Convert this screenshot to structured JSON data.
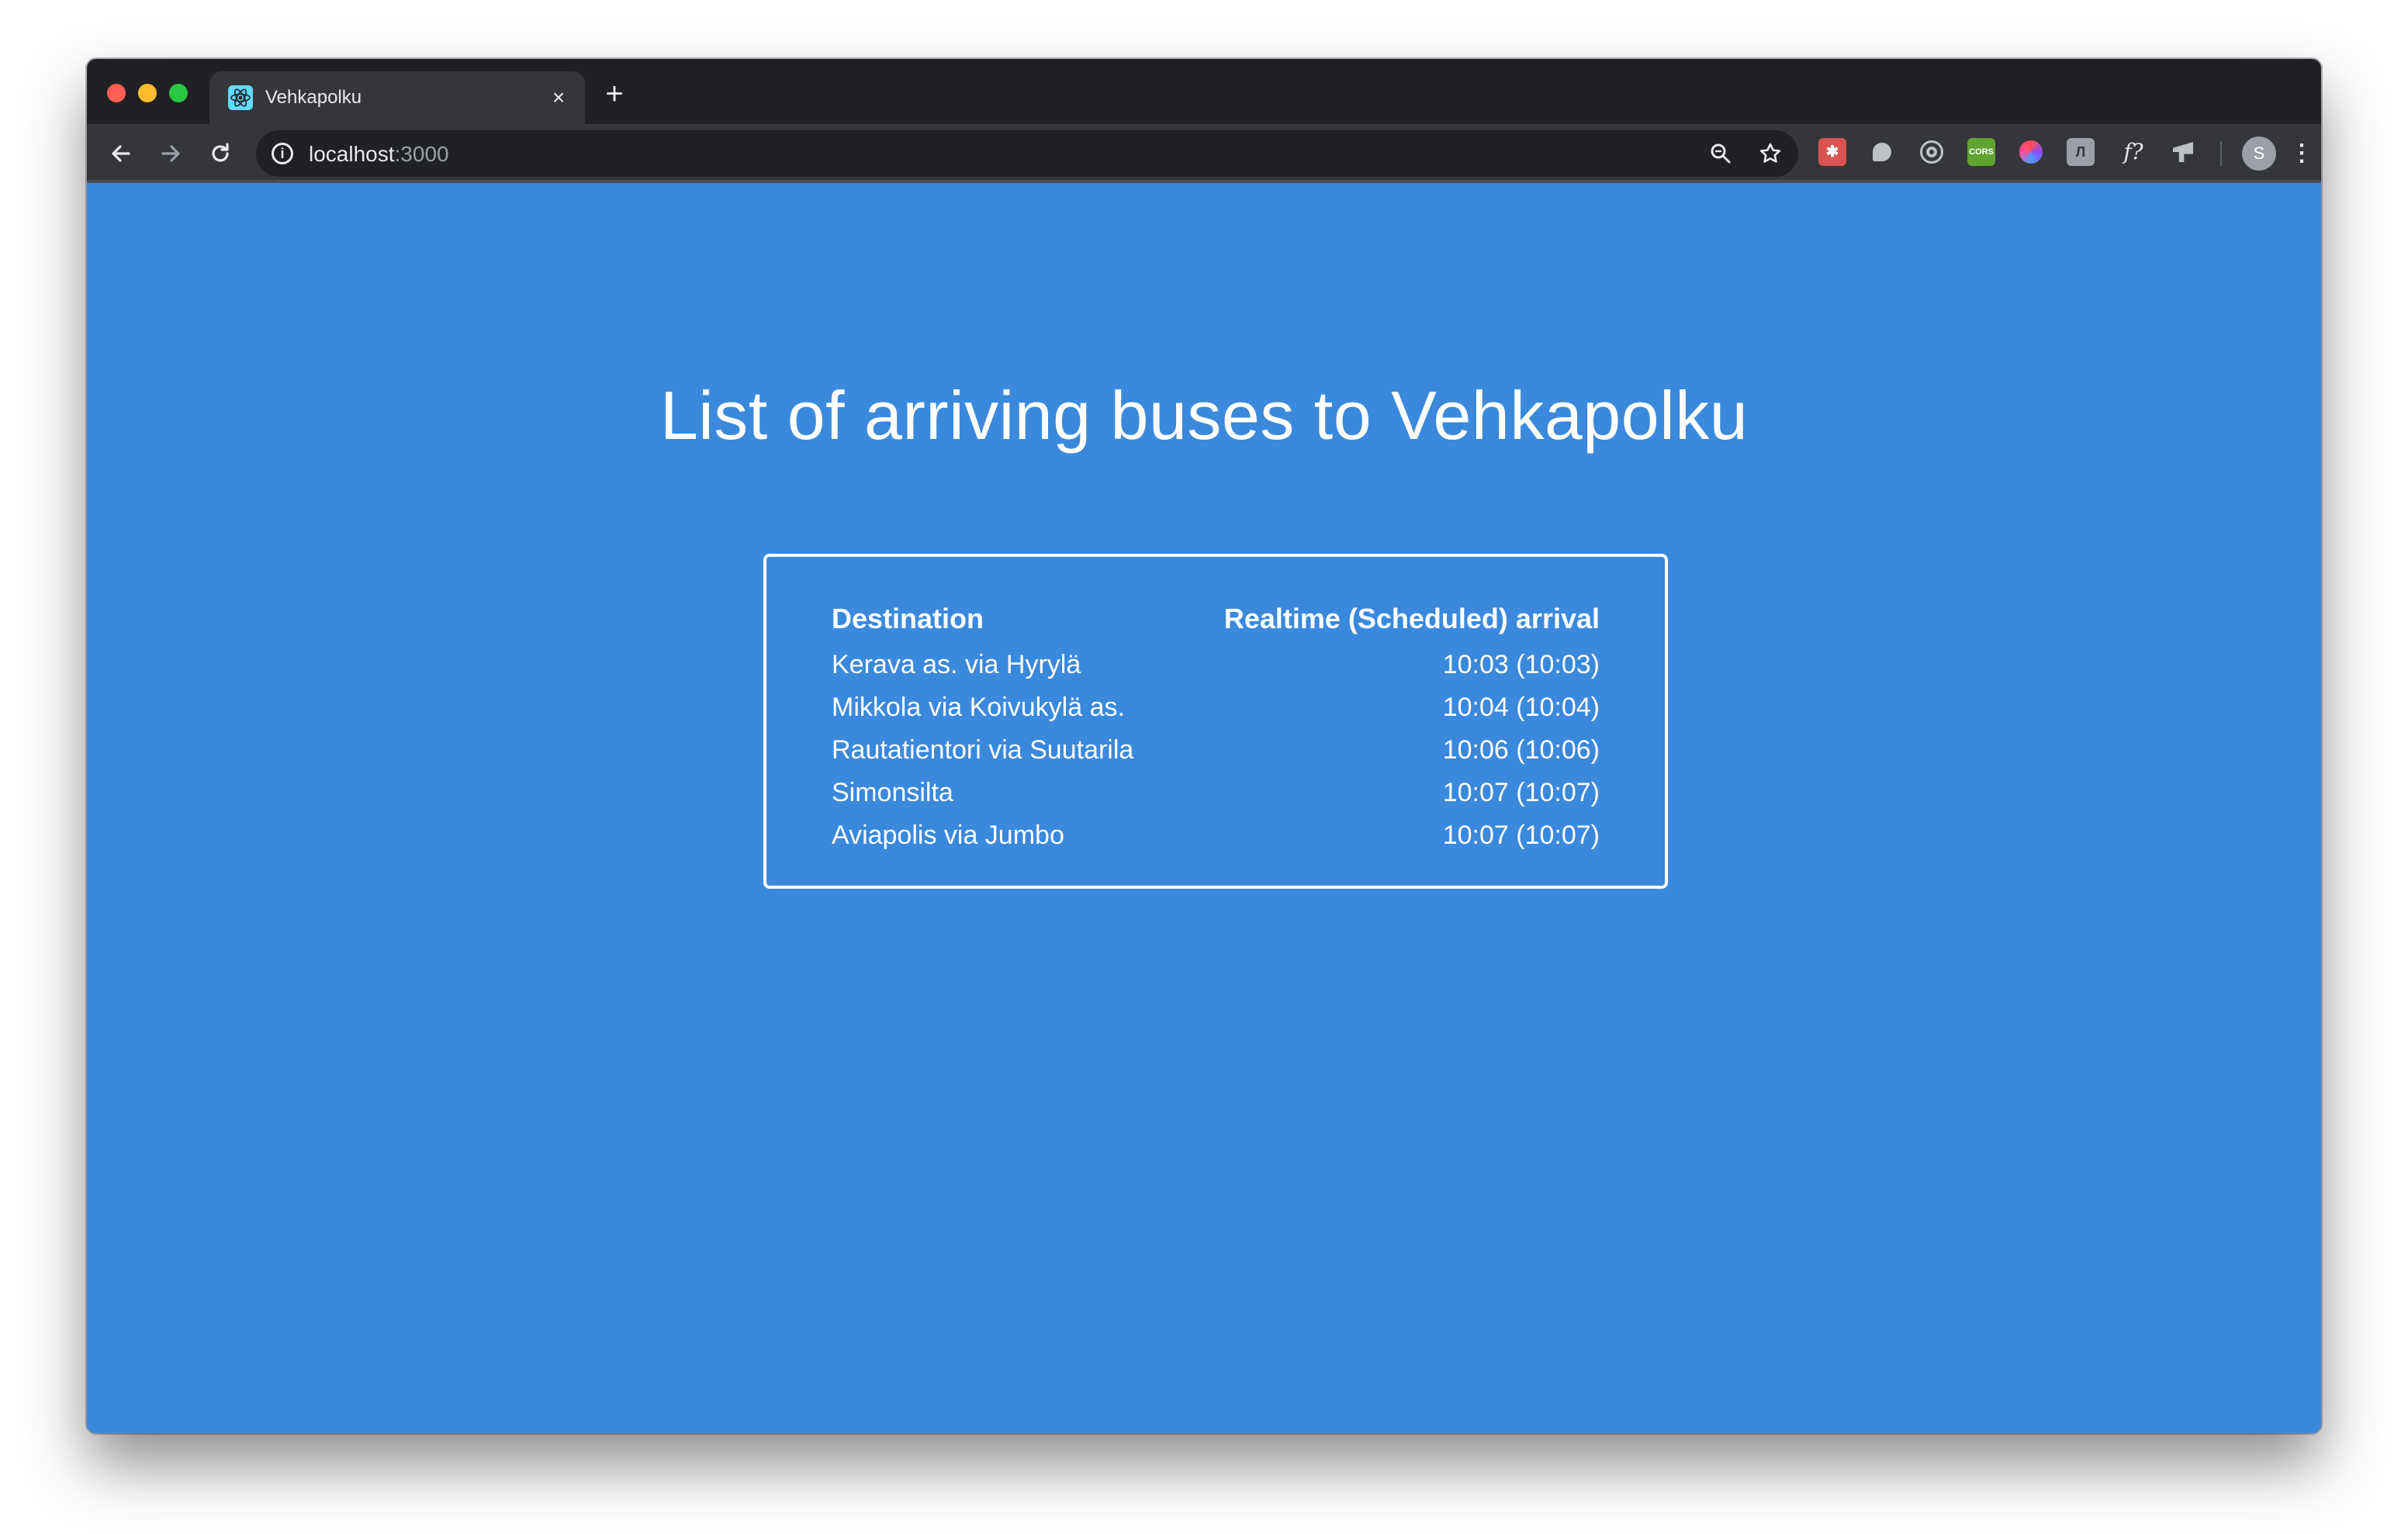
{
  "browser": {
    "tab_title": "Vehkapolku",
    "tab_close": "×",
    "new_tab": "+",
    "url_host": "localhost",
    "url_port": ":3000",
    "avatar_letter": "S",
    "ext_function_label": "f?",
    "ext_cors_label": "CORS"
  },
  "page": {
    "title": "List of arriving buses to Vehkapolku",
    "table": {
      "headers": {
        "destination": "Destination",
        "arrival": "Realtime (Scheduled) arrival"
      },
      "rows": [
        {
          "destination": "Kerava as. via Hyrylä",
          "arrival": "10:03 (10:03)"
        },
        {
          "destination": "Mikkola via Koivukylä as.",
          "arrival": "10:04 (10:04)"
        },
        {
          "destination": "Rautatientori via Suutarila",
          "arrival": "10:06 (10:06)"
        },
        {
          "destination": "Simonsilta",
          "arrival": "10:07 (10:07)"
        },
        {
          "destination": "Aviapolis via Jumbo",
          "arrival": "10:07 (10:07)"
        }
      ]
    }
  },
  "colors": {
    "page_background": "#3a89dc",
    "chrome_dark": "#202124",
    "chrome_toolbar": "#35363a",
    "text": "#ffffff"
  },
  "icons": {
    "favicon": "react-logo-icon",
    "back": "arrow-left-icon",
    "forward": "arrow-right-icon",
    "reload": "reload-icon",
    "site_info": "info-icon",
    "zoom": "zoom-icon",
    "bookmark": "star-icon",
    "menu": "more-vertical-icon"
  }
}
